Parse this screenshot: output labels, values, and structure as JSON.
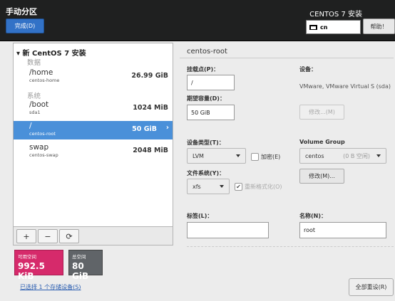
{
  "header": {
    "title": "手动分区",
    "done_label": "完成(D)",
    "product": "CENTOS 7 安装",
    "keyboard_layout": "cn",
    "help_label": "帮助！"
  },
  "tree": {
    "root_label": "新 CentOS 7 安装",
    "groups": [
      {
        "label": "数据"
      },
      {
        "label": "系统"
      }
    ],
    "items": [
      {
        "mount": "/home",
        "device": "centos-home",
        "size": "26.99 GiB"
      },
      {
        "mount": "/boot",
        "device": "sda1",
        "size": "1024 MiB"
      },
      {
        "mount": "/",
        "device": "centos-root",
        "size": "50 GiB"
      },
      {
        "mount": "swap",
        "device": "centos-swap",
        "size": "2048 MiB"
      }
    ],
    "toolbar": {
      "add": "+",
      "remove": "−",
      "refresh": "⟳"
    }
  },
  "space": {
    "available_label": "可用空间",
    "available_value": "992.5 KiB",
    "total_label": "总空间",
    "total_value": "80 GiB"
  },
  "storage_link": "已选择 1 个存储设备(S)",
  "reset_label": "全部重设(R)",
  "details": {
    "title": "centos-root",
    "mount_label": "挂载点(P)：",
    "mount_value": "/",
    "capacity_label": "期望容量(D)：",
    "capacity_value": "50 GiB",
    "device_label": "设备：",
    "device_desc": "VMware, VMware Virtual S (sda)",
    "modify_device_label": "修改...(M)",
    "device_type_label": "设备类型(T)：",
    "device_type_value": "LVM",
    "encrypt_label": "加密(E)",
    "volume_group_label": "Volume Group",
    "volume_group_value": "centos",
    "volume_group_free": "(0 B 空闲)",
    "modify_vg_label": "修改(M)...",
    "fs_label": "文件系统(Y)：",
    "fs_value": "xfs",
    "reformat_label": "重新格式化(O)",
    "tag_label": "标签(L)：",
    "tag_value": "",
    "name_label": "名称(N)：",
    "name_value": "root"
  }
}
